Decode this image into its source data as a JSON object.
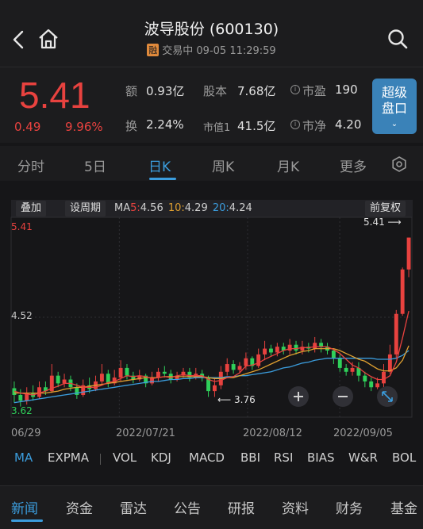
{
  "header": {
    "title": "波导股份 (600130)",
    "badge": "融",
    "status": "交易中 09-05 11:29:59"
  },
  "quote": {
    "price": "5.41",
    "change": "0.49",
    "change_pct": "9.96%",
    "amount_label": "额",
    "amount_value": "0.93亿",
    "capital_label": "股本",
    "capital_value": "7.68亿",
    "pe_label": "市盈",
    "pe_value": "190",
    "turnover_label": "换",
    "turnover_value": "2.24%",
    "mcap_label": "市值1",
    "mcap_value": "41.5亿",
    "pb_label": "市净",
    "pb_value": "4.20",
    "super_button": "超级盘口"
  },
  "period_tabs": [
    {
      "label": "分时"
    },
    {
      "label": "5日"
    },
    {
      "label": "日K"
    },
    {
      "label": "周K"
    },
    {
      "label": "月K"
    },
    {
      "label": "更多"
    }
  ],
  "chart_toolbar": {
    "overlay": "叠加",
    "set_period": "设周期",
    "ma_prefix": "MA",
    "ma5_label": "5:",
    "ma5_value": "4.56",
    "ma10_label": "10:",
    "ma10_value": "4.29",
    "ma20_label": "20:",
    "ma20_value": "4.24",
    "adjust": "前复权"
  },
  "colors": {
    "up": "#e8423f",
    "down": "#2fd05a",
    "ma5": "#e8423f",
    "ma10": "#e0a030",
    "ma20": "#3b9ddd",
    "accent": "#3b9ddd"
  },
  "chart_data": {
    "type": "candlestick",
    "y_labels": {
      "top": "5.41",
      "mid": "4.52",
      "low": "3.62"
    },
    "max_marker": "5.41",
    "min_marker": "3.76",
    "ylim": [
      3.55,
      5.62
    ],
    "dates": [
      "2022/06/29",
      "2022/07/21",
      "2022/08/12",
      "2022/09/05"
    ],
    "date_labels_display": [
      "06/29",
      "2022/07/21",
      "2022/08/12",
      "2022/09/05"
    ],
    "candles": [
      [
        3.85,
        3.78,
        3.92,
        3.7
      ],
      [
        3.78,
        3.72,
        3.84,
        3.66
      ],
      [
        3.72,
        3.8,
        3.86,
        3.68
      ],
      [
        3.8,
        3.76,
        3.88,
        3.72
      ],
      [
        3.76,
        3.86,
        3.92,
        3.74
      ],
      [
        3.86,
        3.82,
        3.92,
        3.78
      ],
      [
        3.82,
        3.98,
        4.1,
        3.8
      ],
      [
        3.98,
        3.9,
        4.02,
        3.86
      ],
      [
        3.9,
        3.94,
        4.0,
        3.86
      ],
      [
        3.94,
        3.86,
        3.98,
        3.82
      ],
      [
        3.86,
        3.78,
        3.9,
        3.74
      ],
      [
        3.78,
        3.88,
        3.94,
        3.76
      ],
      [
        3.88,
        3.84,
        3.96,
        3.8
      ],
      [
        3.84,
        3.92,
        3.98,
        3.82
      ],
      [
        3.92,
        4.0,
        4.1,
        3.88
      ],
      [
        4.0,
        3.9,
        4.04,
        3.86
      ],
      [
        3.9,
        3.96,
        4.04,
        3.88
      ],
      [
        3.96,
        4.06,
        4.14,
        3.92
      ],
      [
        4.06,
        3.98,
        4.1,
        3.94
      ],
      [
        3.98,
        3.94,
        4.02,
        3.9
      ],
      [
        3.94,
        3.98,
        4.04,
        3.92
      ],
      [
        3.98,
        3.9,
        4.0,
        3.86
      ],
      [
        3.9,
        3.96,
        4.02,
        3.88
      ],
      [
        3.96,
        4.02,
        4.06,
        3.92
      ],
      [
        4.02,
        4.0,
        4.08,
        3.96
      ],
      [
        4.0,
        3.94,
        4.04,
        3.9
      ],
      [
        3.94,
        3.98,
        4.02,
        3.92
      ],
      [
        3.98,
        4.02,
        4.06,
        3.96
      ],
      [
        4.02,
        3.96,
        4.06,
        3.92
      ],
      [
        3.96,
        4.0,
        4.06,
        3.94
      ],
      [
        4.0,
        3.96,
        4.04,
        3.92
      ],
      [
        3.96,
        3.82,
        3.98,
        3.76
      ],
      [
        3.82,
        3.88,
        3.96,
        3.76
      ],
      [
        3.88,
        4.02,
        4.08,
        3.84
      ],
      [
        4.02,
        4.1,
        4.16,
        3.98
      ],
      [
        4.1,
        4.04,
        4.14,
        4.0
      ],
      [
        4.04,
        4.08,
        4.12,
        4.0
      ],
      [
        4.08,
        4.16,
        4.22,
        4.04
      ],
      [
        4.16,
        4.08,
        4.18,
        4.04
      ],
      [
        4.08,
        4.2,
        4.26,
        4.06
      ],
      [
        4.2,
        4.26,
        4.34,
        4.14
      ],
      [
        4.26,
        4.22,
        4.3,
        4.18
      ],
      [
        4.22,
        4.28,
        4.32,
        4.18
      ],
      [
        4.28,
        4.24,
        4.32,
        4.2
      ],
      [
        4.24,
        4.3,
        4.36,
        4.2
      ],
      [
        4.3,
        4.24,
        4.34,
        4.2
      ],
      [
        4.24,
        4.28,
        4.34,
        4.2
      ],
      [
        4.28,
        4.26,
        4.32,
        4.22
      ],
      [
        4.26,
        4.32,
        4.38,
        4.22
      ],
      [
        4.32,
        4.28,
        4.36,
        4.22
      ],
      [
        4.28,
        4.24,
        4.32,
        4.2
      ],
      [
        4.24,
        4.16,
        4.26,
        4.1
      ],
      [
        4.16,
        4.06,
        4.2,
        4.02
      ],
      [
        4.06,
        4.02,
        4.1,
        3.98
      ],
      [
        4.02,
        4.06,
        4.12,
        3.98
      ],
      [
        4.06,
        3.98,
        4.12,
        3.92
      ],
      [
        3.98,
        3.92,
        4.02,
        3.86
      ],
      [
        3.92,
        3.86,
        3.96,
        3.82
      ],
      [
        3.86,
        3.9,
        3.96,
        3.84
      ],
      [
        3.9,
        4.02,
        4.1,
        3.86
      ],
      [
        4.02,
        4.2,
        4.3,
        4.0
      ],
      [
        4.2,
        4.62,
        4.66,
        4.16
      ],
      [
        4.62,
        5.08,
        5.1,
        4.6
      ],
      [
        5.08,
        5.41,
        5.41,
        5.0
      ]
    ],
    "ma5": [
      3.82,
      3.8,
      3.79,
      3.78,
      3.8,
      3.82,
      3.85,
      3.87,
      3.9,
      3.9,
      3.88,
      3.86,
      3.86,
      3.86,
      3.88,
      3.91,
      3.92,
      3.95,
      3.98,
      3.97,
      3.98,
      3.97,
      3.95,
      3.96,
      3.97,
      3.96,
      3.98,
      3.99,
      3.98,
      3.98,
      3.98,
      3.94,
      3.92,
      3.93,
      3.96,
      3.97,
      4.01,
      4.08,
      4.09,
      4.11,
      4.15,
      4.18,
      4.21,
      4.24,
      4.26,
      4.26,
      4.27,
      4.27,
      4.28,
      4.28,
      4.28,
      4.25,
      4.21,
      4.15,
      4.09,
      4.06,
      4.01,
      3.97,
      3.94,
      3.94,
      3.98,
      4.12,
      4.37,
      4.65
    ],
    "ma10": [
      3.8,
      3.8,
      3.8,
      3.8,
      3.8,
      3.8,
      3.81,
      3.82,
      3.84,
      3.85,
      3.86,
      3.86,
      3.87,
      3.88,
      3.89,
      3.9,
      3.91,
      3.92,
      3.93,
      3.94,
      3.95,
      3.96,
      3.96,
      3.96,
      3.97,
      3.97,
      3.97,
      3.97,
      3.97,
      3.97,
      3.97,
      3.96,
      3.95,
      3.95,
      3.96,
      3.96,
      3.98,
      4.0,
      4.02,
      4.04,
      4.07,
      4.1,
      4.13,
      4.16,
      4.19,
      4.21,
      4.23,
      4.24,
      4.26,
      4.26,
      4.26,
      4.26,
      4.24,
      4.21,
      4.18,
      4.15,
      4.13,
      4.09,
      4.05,
      4.03,
      4.03,
      4.06,
      4.14,
      4.29
    ],
    "ma20": [
      3.7,
      3.71,
      3.72,
      3.73,
      3.74,
      3.75,
      3.76,
      3.77,
      3.78,
      3.79,
      3.8,
      3.81,
      3.82,
      3.83,
      3.84,
      3.85,
      3.86,
      3.87,
      3.88,
      3.89,
      3.9,
      3.91,
      3.92,
      3.92,
      3.93,
      3.94,
      3.94,
      3.95,
      3.95,
      3.96,
      3.96,
      3.96,
      3.96,
      3.96,
      3.97,
      3.97,
      3.98,
      3.98,
      3.99,
      4.0,
      4.01,
      4.02,
      4.04,
      4.06,
      4.07,
      4.09,
      4.11,
      4.12,
      4.14,
      4.15,
      4.16,
      4.16,
      4.16,
      4.16,
      4.16,
      4.16,
      4.16,
      4.16,
      4.15,
      4.15,
      4.15,
      4.16,
      4.19,
      4.24
    ]
  },
  "indicators": [
    {
      "label": "MA"
    },
    {
      "label": "EXPMA"
    },
    {
      "label": "VOL"
    },
    {
      "label": "KDJ"
    },
    {
      "label": "MACD"
    },
    {
      "label": "BBI"
    },
    {
      "label": "RSI"
    },
    {
      "label": "BIAS"
    },
    {
      "label": "W&R"
    },
    {
      "label": "BOL"
    }
  ],
  "bottom_tabs": [
    {
      "label": "新闻"
    },
    {
      "label": "资金"
    },
    {
      "label": "雷达"
    },
    {
      "label": "公告"
    },
    {
      "label": "研报"
    },
    {
      "label": "资料"
    },
    {
      "label": "财务"
    },
    {
      "label": "基金"
    }
  ]
}
